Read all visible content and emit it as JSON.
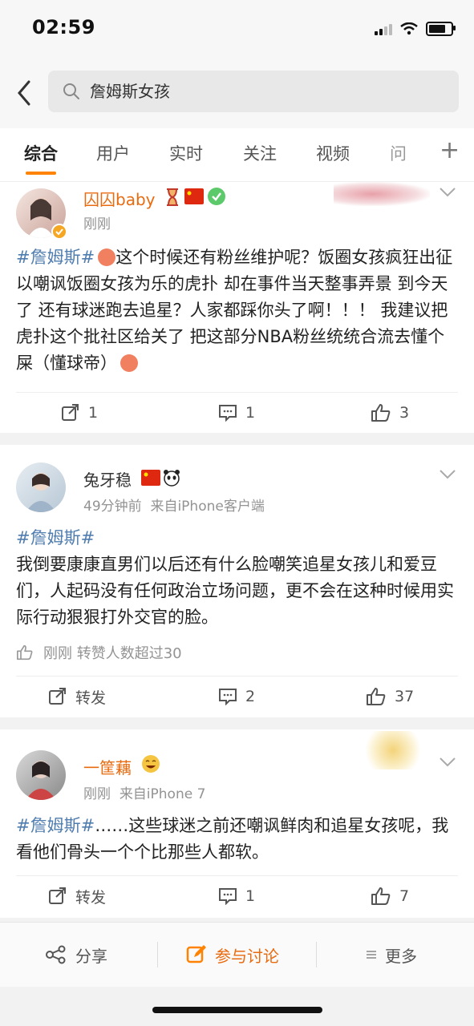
{
  "status": {
    "time": "02:59"
  },
  "search": {
    "query": "詹姆斯女孩"
  },
  "tabs": [
    "综合",
    "用户",
    "实时",
    "关注",
    "视频",
    "问"
  ],
  "posts": [
    {
      "name": "囚囚baby",
      "meta": "刚刚",
      "tag": "#詹姆斯#",
      "text": "这个时候还有粉丝维护呢？饭圈女孩疯狂出征 以嘲讽饭圈女孩为乐的虎扑 却在事件当天整事弄景 到今天了 还有球迷跑去追星？人家都踩你头了啊！！！ 我建议把虎扑这个批社区给关了 把这部分NBA粉丝统统合流去懂个屎（懂球帝）",
      "repost": "1",
      "comment": "1",
      "like": "3"
    },
    {
      "name": "兔牙稳",
      "meta_time": "49分钟前",
      "meta_source": "来自iPhone客户端",
      "tag": "#詹姆斯#",
      "text": "我倒要康康直男们以后还有什么脸嘲笑追星女孩儿和爱豆们，人起码没有任何政治立场问题，更不会在这种时候用实际行动狠狠打外交官的脸。",
      "like_info": "刚刚 转赞人数超过30",
      "repost": "转发",
      "comment": "2",
      "like": "37"
    },
    {
      "name": "一筐藕",
      "meta_time": "刚刚",
      "meta_source": "来自iPhone 7",
      "tag": "#詹姆斯#",
      "text": "……这些球迷之前还嘲讽鲜肉和追星女孩呢，我看他们骨头一个个比那些人都软。",
      "repost": "转发",
      "comment": "1",
      "like": "7"
    }
  ],
  "bottom": {
    "share": "分享",
    "discuss": "参与讨论",
    "more": "更多"
  },
  "colors": {
    "accent": "#ff8200",
    "link": "#507daf",
    "vip_name": "#e86b10"
  }
}
